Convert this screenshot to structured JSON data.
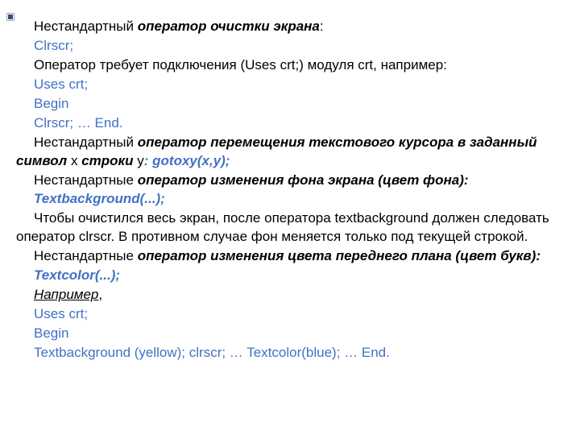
{
  "l1a": "Нестандартный  ",
  "l1b": "оператор очистки экрана",
  "l1c": ":",
  "l2": "Clrscr;",
  "l3": "Оператор требует подключения (Uses crt;)  модуля crt, например:",
  "l4": "Uses crt;",
  "l5": "Begin",
  "l6": "Clrscr;  …  End.",
  "l7a": "Нестандартный  ",
  "l7b": "оператор перемещения текстового курсора в заданный символ ",
  "l7c": "х ",
  "l7d": "строки ",
  "l7e": "у",
  "l7f": ": gotoxy(x,y);",
  "l8a": "Нестандартные ",
  "l8b": "оператор изменения фона экрана (цвет фона):",
  "l9": "Textbackground(...);",
  "l10": "Чтобы очистился весь экран, после оператора textbackground должен следовать оператор clrscr. В противном случае фон меняется только под текущей строкой.",
  "l11a": "Нестандартные ",
  "l11b": "оператор изменения цвета переднего плана (цвет букв):",
  "l12": "Textcolor(...);",
  "l13a": " Например",
  "l13b": ",",
  "l14": "Uses crt;",
  "l15": "Begin",
  "l16": "Textbackground (yellow); clrscr; … Textcolor(blue); … End."
}
